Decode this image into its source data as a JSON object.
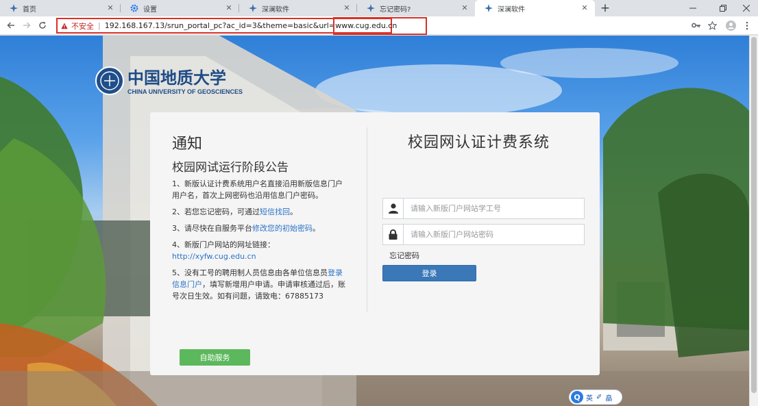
{
  "browser": {
    "tabs": [
      {
        "label": "首页",
        "icon": "compass-icon"
      },
      {
        "label": "设置",
        "icon": "gear-icon"
      },
      {
        "label": "深澜软件",
        "icon": "compass-icon"
      },
      {
        "label": "忘记密码?",
        "icon": "compass-icon"
      },
      {
        "label": "深澜软件",
        "icon": "compass-icon",
        "active": true
      }
    ],
    "new_tab": "+",
    "address": {
      "security_label": "不安全",
      "separator": "|",
      "url_main": "192.168.167.13/srun_portal_pc?ac_id=3&theme=basic&url=",
      "url_highlight": "www.cug.edu.cn"
    }
  },
  "notice": {
    "heading": "通知",
    "subheading": "校园网试运行阶段公告",
    "items": [
      {
        "text": "1、新版认证计费系统用户名直接沿用新版信息门户用户名，首次上网密码也沿用信息门户密码。"
      },
      {
        "prefix": "2、若您忘记密码，可通过",
        "link": "短信找回",
        "suffix": "。"
      },
      {
        "prefix": "3、请尽快在自服务平台",
        "link": "修改您的初始密码",
        "suffix": "。"
      },
      {
        "prefix": "4、新版门户网站的网址链接：",
        "link": "http://xyfw.cug.edu.cn",
        "suffix": ""
      },
      {
        "prefix": "5、没有工号的聘用制人员信息由各单位信息员",
        "link": "登录信息门户",
        "suffix": "，填写新增用户申请。申请审核通过后，账号次日生效。如有问题，请致电：67885173"
      }
    ],
    "self_service_label": "自助服务"
  },
  "login": {
    "title": "校园网认证计费系统",
    "username_placeholder": "请输入新版门户网站学工号",
    "password_placeholder": "请输入新版门户网站密码",
    "forgot_label": "忘记密码",
    "submit_label": "登录"
  },
  "ime": {
    "logo": "Q",
    "mode": "英",
    "tools": "✐",
    "skin": "皛"
  }
}
